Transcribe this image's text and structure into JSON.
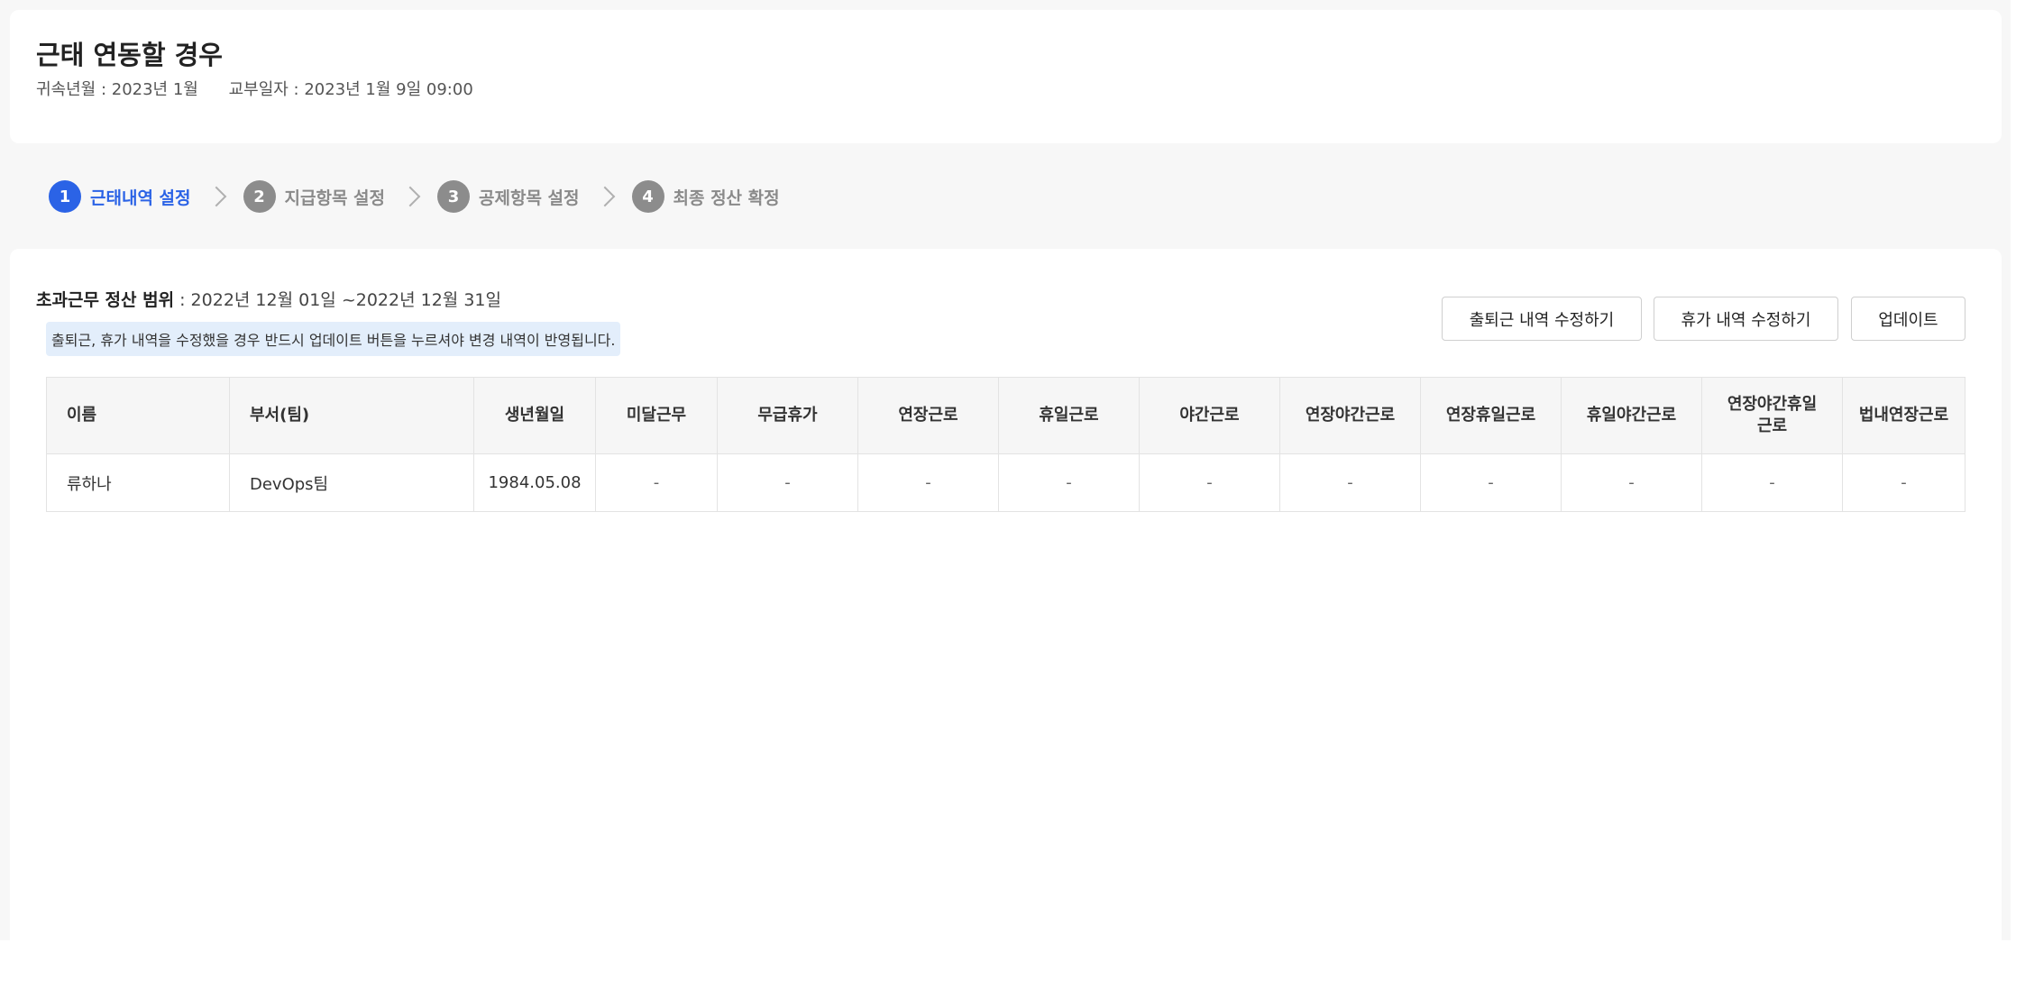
{
  "header": {
    "title": "근태 연동할 경우",
    "belong_period": "귀속년월 : 2023년 1월",
    "pay_date": "교부일자 : 2023년 1월 9일 09:00"
  },
  "steps": [
    {
      "num": "1",
      "label": "근태내역 설정",
      "active": true
    },
    {
      "num": "2",
      "label": "지급항목 설정",
      "active": false
    },
    {
      "num": "3",
      "label": "공제항목 설정",
      "active": false
    },
    {
      "num": "4",
      "label": "최종 정산 확정",
      "active": false
    }
  ],
  "main": {
    "range_label": "초과근무 정산 범위",
    "range_value": " : 2022년 12월 01일 ~2022년 12월 31일",
    "notice": "출퇴근, 휴가 내역을 수정했을 경우 반드시 업데이트 버튼을 누르셔야 변경 내역이 반영됩니다.",
    "buttons": {
      "edit_attendance": "출퇴근 내역 수정하기",
      "edit_leave": "휴가 내역 수정하기",
      "update": "업데이트"
    }
  },
  "table": {
    "columns": [
      "이름",
      "부서(팀)",
      "생년월일",
      "미달근무",
      "무급휴가",
      "연장근로",
      "휴일근로",
      "야간근로",
      "연장야간근로",
      "연장휴일근로",
      "휴일야간근로",
      "연장야간휴일\n근로",
      "법내연장근로"
    ],
    "rows": [
      [
        "류하나",
        "DevOps팀",
        "1984.05.08",
        "-",
        "-",
        "-",
        "-",
        "-",
        "-",
        "-",
        "-",
        "-",
        "-"
      ]
    ]
  }
}
